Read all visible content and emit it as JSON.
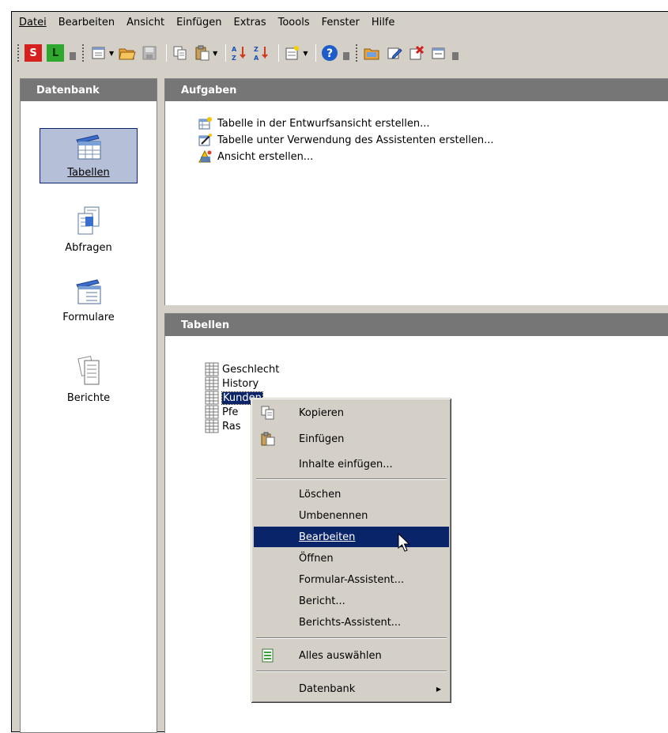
{
  "menubar": {
    "items": [
      "Datei",
      "Bearbeiten",
      "Ansicht",
      "Einfügen",
      "Extras",
      "Toools",
      "Fenster",
      "Hilfe"
    ]
  },
  "toolbar": {
    "s_label": "S",
    "l_label": "L"
  },
  "left_panel": {
    "header": "Datenbank",
    "categories": [
      "Tabellen",
      "Abfragen",
      "Formulare",
      "Berichte"
    ],
    "selected": "Tabellen"
  },
  "tasks_panel": {
    "header": "Aufgaben",
    "tasks": [
      "Tabelle in der Entwurfsansicht erstellen...",
      "Tabelle unter Verwendung des Assistenten erstellen...",
      "Ansicht erstellen..."
    ]
  },
  "tables_panel": {
    "header": "Tabellen",
    "tables": [
      "Geschlecht",
      "History",
      "Kunden",
      "Pfe",
      "Ras"
    ],
    "selected": "Kunden"
  },
  "context_menu": {
    "items": [
      "Kopieren",
      "Einfügen",
      "Inhalte einfügen...",
      "Löschen",
      "Umbenennen",
      "Bearbeiten",
      "Öffnen",
      "Formular-Assistent...",
      "Bericht...",
      "Berichts-Assistent...",
      "Alles auswählen",
      "Datenbank"
    ],
    "highlighted": "Bearbeiten"
  },
  "colors": {
    "window_bg": "#d4d0c8",
    "header_bg": "#767676",
    "highlight": "#0a246a",
    "selected_category_bg": "#b5bfd7"
  }
}
